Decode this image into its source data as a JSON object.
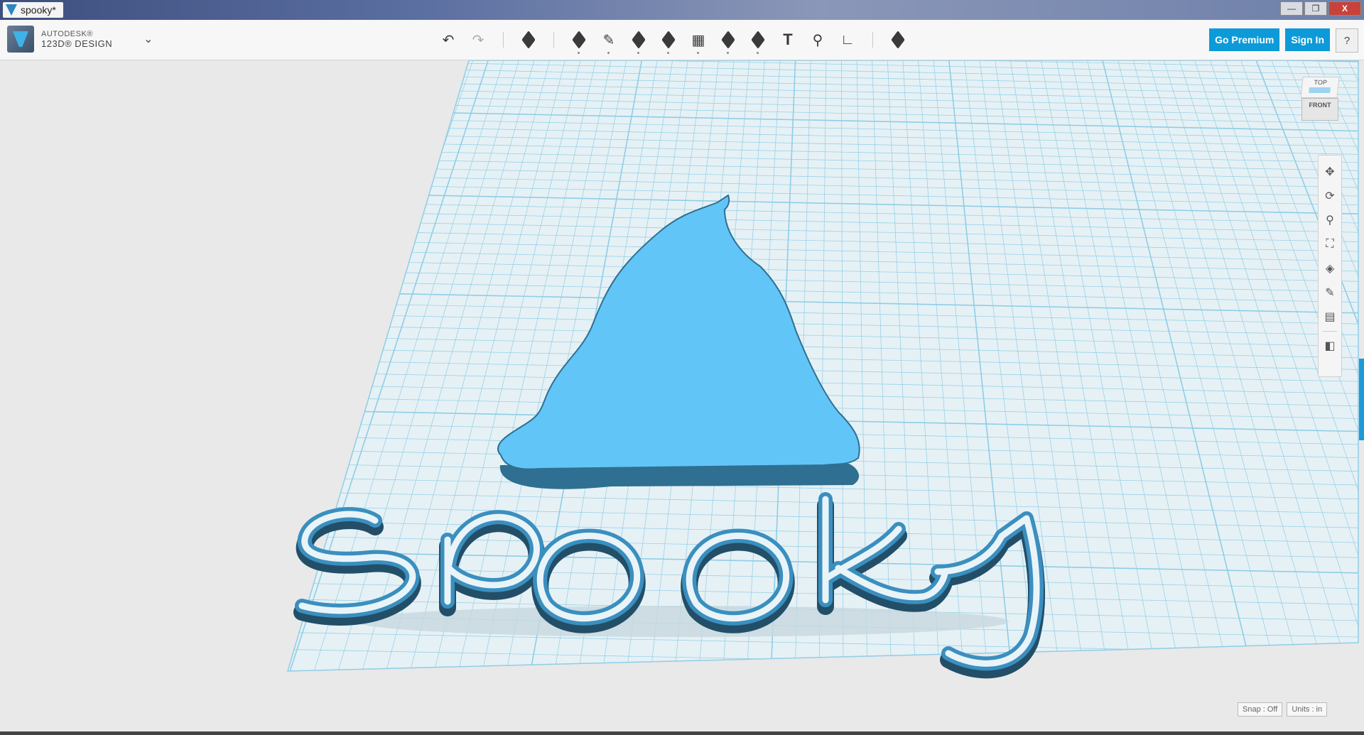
{
  "window": {
    "title": "spooky*",
    "controls": {
      "minimize": "—",
      "maximize": "❐",
      "close": "X"
    }
  },
  "app": {
    "brand": "AUTODESK®",
    "product": "123D® DESIGN",
    "menu_chevron": "⌄"
  },
  "toolbar": {
    "undo": "↶",
    "redo": "↷",
    "text_tool": "T",
    "go_premium": "Go Premium",
    "sign_in": "Sign In",
    "help": "?"
  },
  "viewcube": {
    "top": "TOP",
    "front": "FRONT"
  },
  "model": {
    "word": "spooky"
  },
  "status": {
    "snap": "Snap : Off",
    "units": "Units : in"
  },
  "colors": {
    "grid_line": "#8fcde6",
    "grid_bg": "#e6f1f5",
    "model_fill": "#62c5f7",
    "model_edge": "#2f6f91",
    "accent": "#0d9ad8"
  }
}
